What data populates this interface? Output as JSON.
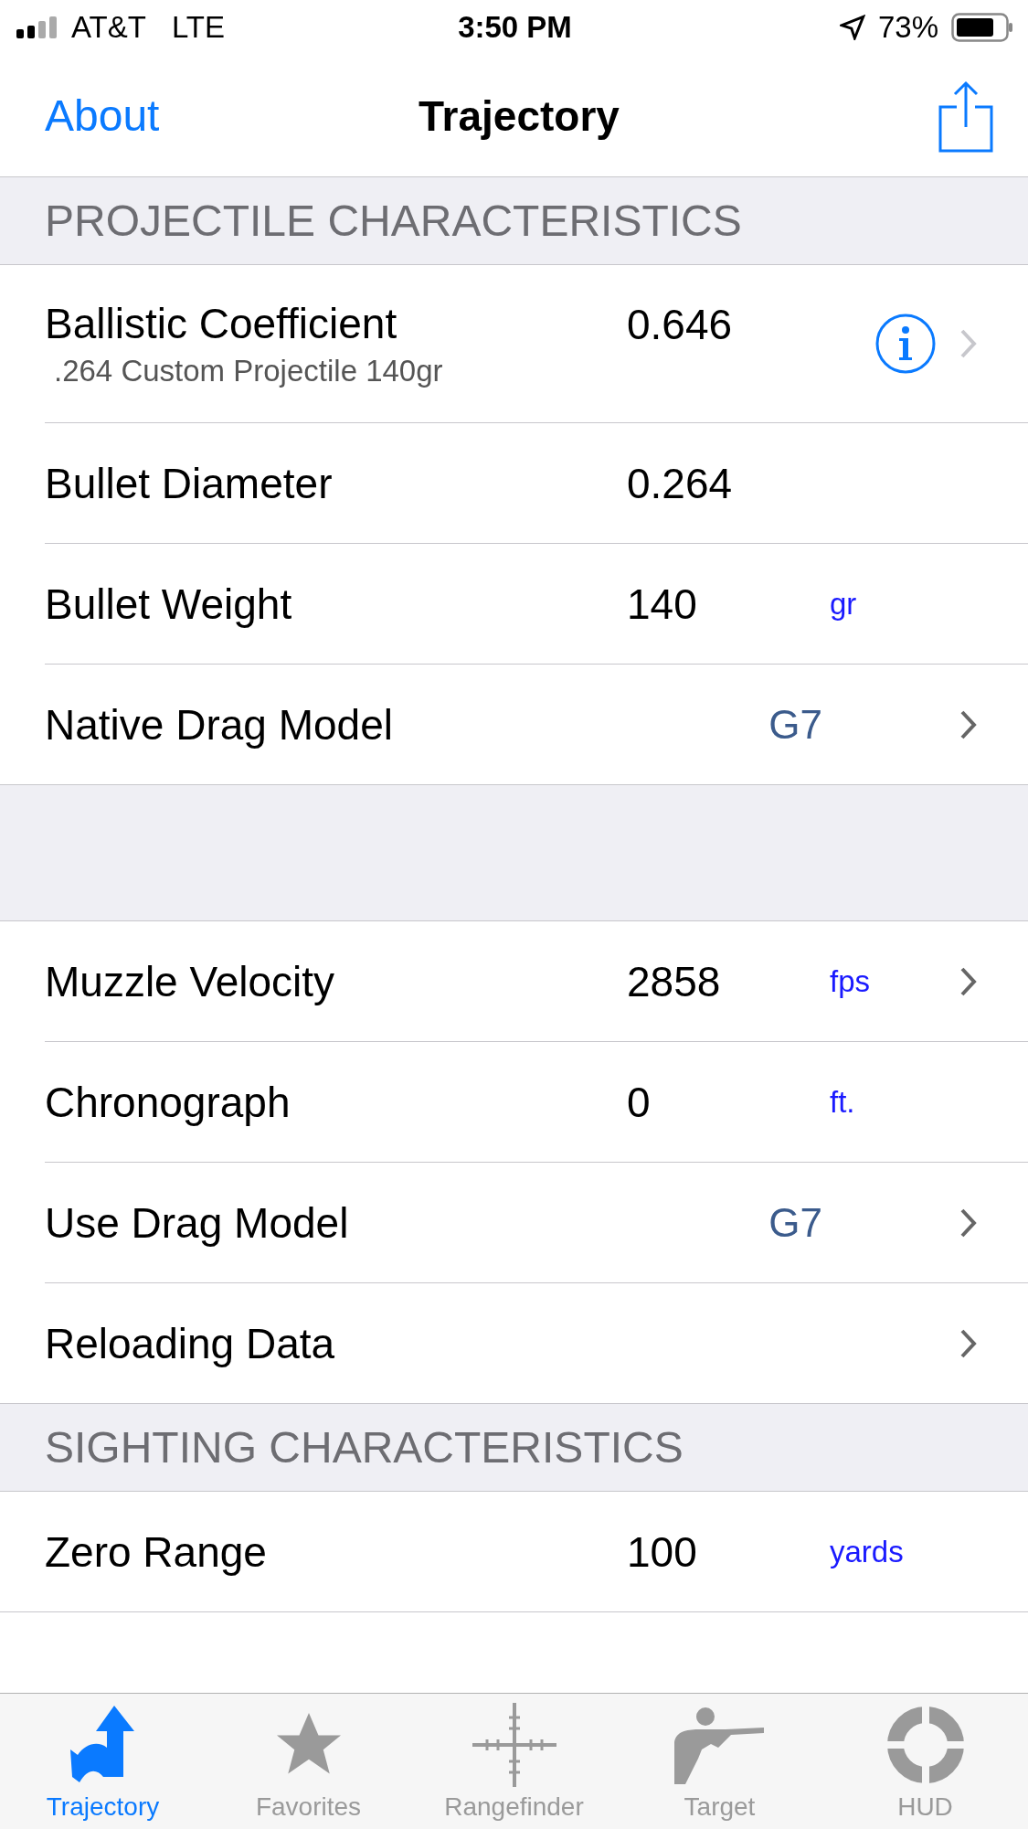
{
  "status_bar": {
    "carrier": "AT&T",
    "network": "LTE",
    "time": "3:50 PM",
    "battery": "73%"
  },
  "nav": {
    "left": "About",
    "title": "Trajectory"
  },
  "sections": [
    {
      "header": "PROJECTILE CHARACTERISTICS",
      "rows": [
        {
          "kind": "number",
          "label": "Ballistic Coefficient",
          "subtitle": ".264 Custom Projectile 140gr",
          "value": "0.646",
          "info": true,
          "chevron": true,
          "chevron_dimmed": true
        },
        {
          "kind": "number",
          "label": "Bullet Diameter",
          "value": "0.264"
        },
        {
          "kind": "number",
          "label": "Bullet Weight",
          "value": "140",
          "unit": "gr"
        },
        {
          "kind": "choice",
          "label": "Native Drag Model",
          "value": "G7",
          "chevron": true,
          "chevron_dimmed": false
        }
      ]
    },
    {
      "rows": [
        {
          "kind": "number",
          "label": "Muzzle Velocity",
          "value": "2858",
          "unit": "fps",
          "chevron": true,
          "chevron_dimmed": false
        },
        {
          "kind": "number",
          "label": "Chronograph",
          "value": "0",
          "unit": "ft."
        },
        {
          "kind": "choice",
          "label": "Use Drag Model",
          "value": "G7",
          "chevron": true,
          "chevron_dimmed": false
        },
        {
          "kind": "link",
          "label": "Reloading Data",
          "chevron": true,
          "chevron_dimmed": false
        }
      ]
    },
    {
      "header": "SIGHTING CHARACTERISTICS",
      "rows": [
        {
          "kind": "number",
          "label": "Zero Range",
          "value": "100",
          "unit": "yards"
        }
      ]
    }
  ],
  "tabs": [
    {
      "label": "Trajectory",
      "selected": true
    },
    {
      "label": "Favorites",
      "selected": false
    },
    {
      "label": "Rangefinder",
      "selected": false
    },
    {
      "label": "Target",
      "selected": false
    },
    {
      "label": "HUD",
      "selected": false
    }
  ]
}
